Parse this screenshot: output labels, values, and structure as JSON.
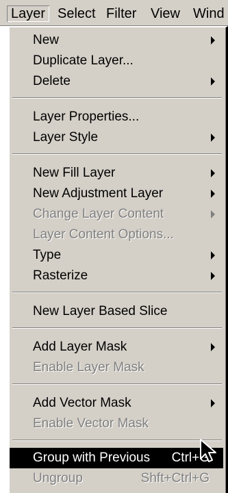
{
  "menubar": {
    "items": [
      {
        "label": "Layer",
        "key": "L",
        "active": true
      },
      {
        "label": "Select",
        "key": "S"
      },
      {
        "label": "Filter",
        "key": "t"
      },
      {
        "label": "View",
        "key": "V"
      },
      {
        "label": "Wind",
        "key": "W"
      }
    ]
  },
  "menu": {
    "items": [
      {
        "label": "New",
        "submenu": true
      },
      {
        "label": "Duplicate Layer..."
      },
      {
        "label": "Delete",
        "submenu": true
      },
      {
        "label": "Layer Properties..."
      },
      {
        "label": "Layer Style",
        "submenu": true
      },
      {
        "label": "New Fill Layer",
        "submenu": true
      },
      {
        "label": "New Adjustment Layer",
        "submenu": true
      },
      {
        "label": "Change Layer Content",
        "submenu": true,
        "disabled": true
      },
      {
        "label": "Layer Content Options...",
        "disabled": true
      },
      {
        "label": "Type",
        "submenu": true
      },
      {
        "label": "Rasterize",
        "submenu": true
      },
      {
        "label": "New Layer Based Slice"
      },
      {
        "label": "Add Layer Mask",
        "submenu": true
      },
      {
        "label": "Enable Layer Mask",
        "disabled": true
      },
      {
        "label": "Add Vector Mask",
        "submenu": true
      },
      {
        "label": "Enable Vector Mask",
        "disabled": true
      },
      {
        "label": "Group with Previous",
        "shortcut": "Ctrl+G",
        "highlighted": true
      },
      {
        "label": "Ungroup",
        "shortcut": "Shft+Ctrl+G",
        "disabled": true
      }
    ]
  },
  "colors": {
    "menu_bg": "#d4d0c8",
    "highlight_bg": "#000000",
    "disabled_text": "#808080"
  }
}
